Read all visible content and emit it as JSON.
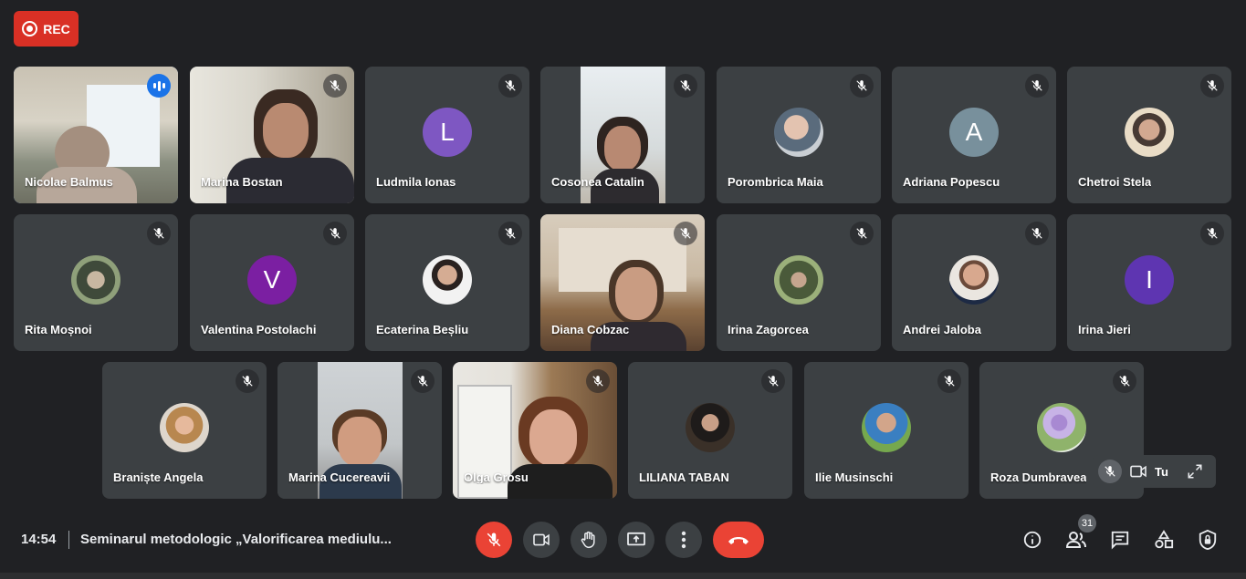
{
  "recording": {
    "label": "REC"
  },
  "tiles": [
    {
      "name": "Nicolae Balmus"
    },
    {
      "name": "Marina Bostan"
    },
    {
      "name": "Ludmila Ionas",
      "initial": "L",
      "color": "#7e57c2"
    },
    {
      "name": "Cosonea Catalin"
    },
    {
      "name": "Porombrica Maia"
    },
    {
      "name": "Adriana Popescu",
      "initial": "A",
      "color": "#78909c"
    },
    {
      "name": "Chetroi Stela"
    },
    {
      "name": "Rita Moșnoi"
    },
    {
      "name": "Valentina Postolachi",
      "initial": "V",
      "color": "#7b1fa2"
    },
    {
      "name": "Ecaterina Beșliu"
    },
    {
      "name": "Diana Cobzac"
    },
    {
      "name": "Irina Zagorcea"
    },
    {
      "name": "Andrei Jaloba"
    },
    {
      "name": "Irina Jieri",
      "initial": "I",
      "color": "#5e35b1"
    },
    {
      "name": "Braniște Angela"
    },
    {
      "name": "Marina Cucereavii"
    },
    {
      "name": "Olga Grosu"
    },
    {
      "name": "LILIANA TABAN"
    },
    {
      "name": "Ilie Musinschi"
    },
    {
      "name": "Roza Dumbravea"
    }
  ],
  "self_view": {
    "label": "Tu"
  },
  "bottombar": {
    "time": "14:54",
    "meeting_title": "Seminarul metodologic „Valorificarea mediulu...",
    "participants_count": "31"
  },
  "colors": {
    "end_call": "#ea4335",
    "active_speaker": "#1a73e8",
    "rec": "#d93025"
  }
}
